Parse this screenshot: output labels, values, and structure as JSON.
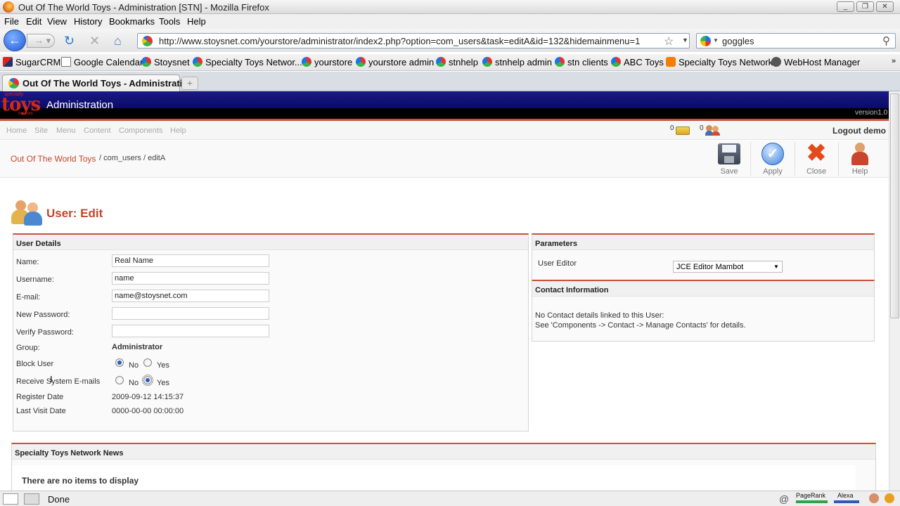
{
  "window": {
    "title": "Out Of The World Toys - Administration [STN] - Mozilla Firefox"
  },
  "menubar": [
    "File",
    "Edit",
    "View",
    "History",
    "Bookmarks",
    "Tools",
    "Help"
  ],
  "navbar": {
    "url": "http://www.stoysnet.com/yourstore/administrator/index2.php?option=com_users&task=editA&id=132&hidemainmenu=1",
    "search": "goggles"
  },
  "bookmarks": [
    "SugarCRM",
    "Google Calendar",
    "Stoysnet",
    "Specialty Toys Networ...",
    "yourstore",
    "yourstore admin",
    "stnhelp",
    "stnhelp admin",
    "stn clients",
    "ABC Toys",
    "Specialty Toys Network",
    "WebHost Manager"
  ],
  "tab": {
    "title": "Out Of The World Toys - Administrati..."
  },
  "admin": {
    "logo": "toys",
    "logo_top": "specialty",
    "logo_sub": "network",
    "header_title": "Administration",
    "version": "version1.0",
    "menu": [
      "Home",
      "Site",
      "Menu",
      "Content",
      "Components",
      "Help"
    ],
    "messages_count": "0",
    "users_count": "0",
    "logout": "Logout demo",
    "breadcrumb_link": "Out Of The World Toys",
    "breadcrumb_rest": "/ com_users / editA",
    "toolbar": [
      "Save",
      "Apply",
      "Close",
      "Help"
    ],
    "page_title": "User: Edit"
  },
  "user_details": {
    "title": "User Details",
    "name_label": "Name:",
    "name_value": "Real Name",
    "username_label": "Username:",
    "username_value": "name",
    "email_label": "E-mail:",
    "email_value": "name@stoysnet.com",
    "newpass_label": "New Password:",
    "verifypass_label": "Verify Password:",
    "group_label": "Group:",
    "group_value": "Administrator",
    "block_label": "Block User",
    "block_value": "No",
    "receive_label": "Receive System E-mails",
    "receive_value": "Yes",
    "no": "No",
    "yes": "Yes",
    "register_label": "Register Date",
    "register_value": "2009-09-12 14:15:37",
    "lastvisit_label": "Last Visit Date",
    "lastvisit_value": "0000-00-00 00:00:00"
  },
  "parameters": {
    "title": "Parameters",
    "editor_label": "User Editor",
    "editor_value": "JCE Editor Mambot"
  },
  "contact": {
    "title": "Contact Information",
    "line1": "No Contact details linked to this User:",
    "line2": "See 'Components -> Contact -> Manage Contacts' for details."
  },
  "news": {
    "title": "Specialty Toys Network News",
    "empty": "There are no items to display"
  },
  "statusbar": {
    "status": "Done",
    "pagerank": "PageRank",
    "alexa": "Alexa"
  },
  "colors": {
    "accent": "#c4452b",
    "header_blue": "#0b0b66"
  }
}
